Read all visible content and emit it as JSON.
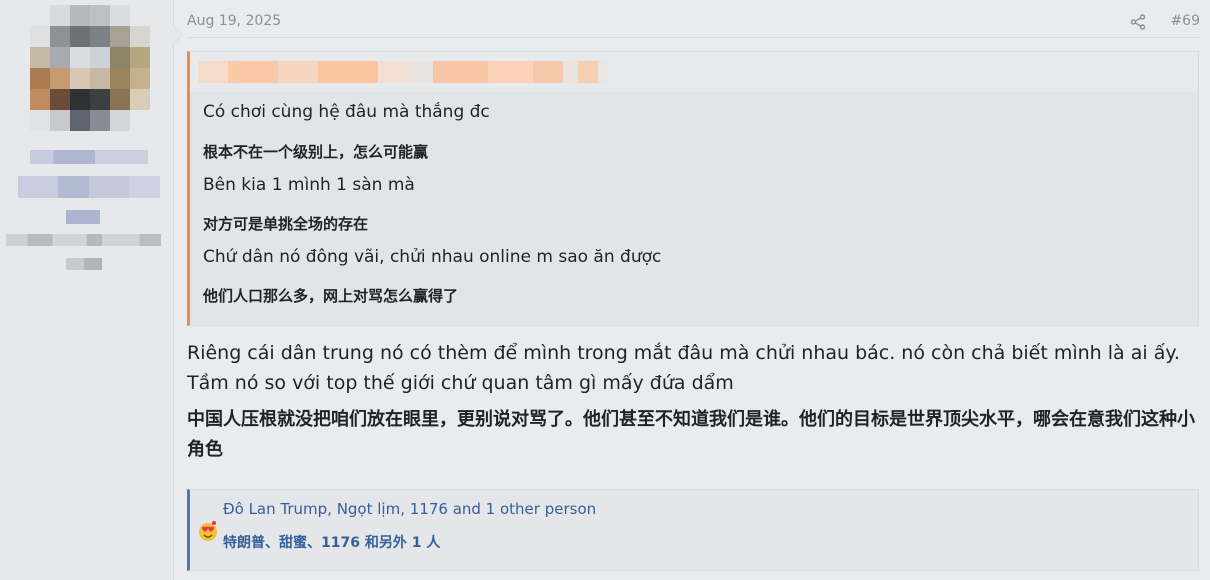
{
  "post": {
    "date": "Aug 19, 2025",
    "number": "#69"
  },
  "quote": {
    "lines": [
      {
        "lang": "vi",
        "text": "Có chơi cùng hệ đâu mà thắng đc"
      },
      {
        "lang": "zh",
        "text": "根本不在一个级别上，怎么可能赢"
      },
      {
        "lang": "vi",
        "text": "Bên kia 1 mình 1 sàn mà"
      },
      {
        "lang": "zh",
        "text": "对方可是单挑全场的存在"
      },
      {
        "lang": "vi",
        "text": "Chứ dân nó đông vãi, chửi nhau online m sao ăn được"
      },
      {
        "lang": "zh",
        "text": "他们人口那么多，网上对骂怎么赢得了"
      }
    ]
  },
  "body": {
    "vi": "Riêng cái dân trung nó có thèm để mình trong mắt đâu mà chửi nhau bác. nó còn chả biết mình là ai ấy. Tầm nó so với top thế giới chứ quan tâm gì mấy đứa dẩm",
    "zh": "中国人压根就没把咱们放在眼里，更别说对骂了。他们甚至不知道我们是谁。他们的目标是世界顶尖水平，哪会在意我们这种小角色"
  },
  "reactions": {
    "vi": "Đô Lan Trump, Ngọt lịm, 1176 and 1 other person",
    "zh": "特朗普、甜蜜、1176 和另外 1 人",
    "icon": "love-face-icon"
  },
  "colors": {
    "quote_accent": "#f28a3c",
    "reaction_accent": "#4a7ab3",
    "link": "#34609a",
    "meta": "#8a9099"
  }
}
